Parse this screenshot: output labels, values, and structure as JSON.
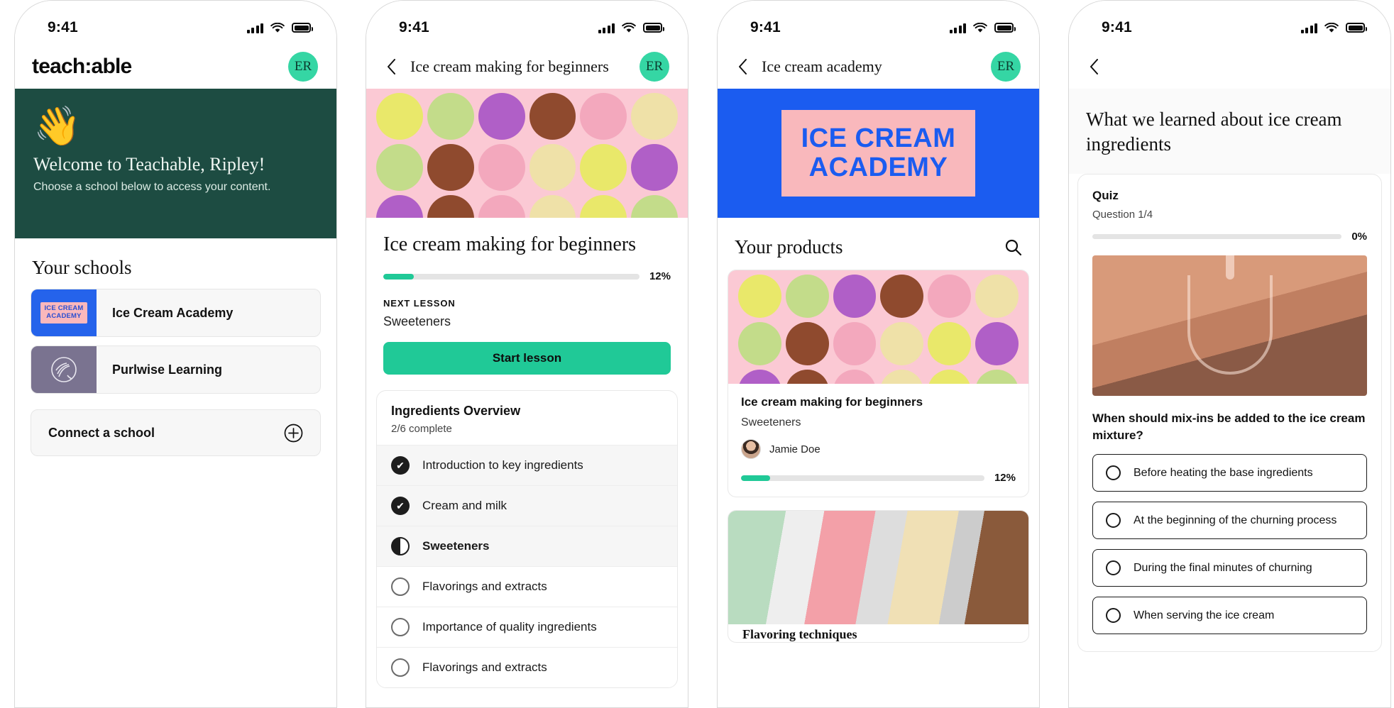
{
  "status_bar": {
    "time": "9:41",
    "signal_icon": "cellular-bars-icon",
    "wifi_icon": "wifi-icon",
    "battery_icon": "battery-icon"
  },
  "colors": {
    "brand_green": "#20c997",
    "avatar_green": "#35D6A4",
    "welcome_bg": "#1d4c42",
    "ica_blue": "#1b5cf0",
    "pink": "#fbc9d4"
  },
  "panel1": {
    "brand": "teach:able",
    "avatar_initials": "ER",
    "wave_icon": "waving-hand-icon",
    "welcome_title": "Welcome to Teachable, Ripley!",
    "welcome_subtitle": "Choose a school below to access your content.",
    "schools_heading": "Your schools",
    "schools": [
      {
        "name": "Ice Cream Academy",
        "logo_icon": "ice-cream-academy-logo",
        "logo_line1": "ICE CREAM",
        "logo_line2": "ACADEMY"
      },
      {
        "name": "Purlwise Learning",
        "logo_icon": "purlwise-learning-logo",
        "logo_caption": "Purlwise Learning"
      }
    ],
    "connect_label": "Connect a school",
    "connect_icon": "plus-circle-icon"
  },
  "panel2": {
    "nav_title": "Ice cream making for beginners",
    "avatar_initials": "ER",
    "back_icon": "chevron-left-icon",
    "hero_icon": "ice-cream-scoops-photo",
    "course_title": "Ice cream making for beginners",
    "progress_percent": "12%",
    "progress_value": 12,
    "eyebrow": "NEXT LESSON",
    "next_lesson": "Sweeteners",
    "start_button": "Start lesson",
    "module_title": "Ingredients Overview",
    "module_progress": "2/6 complete",
    "lessons": [
      {
        "label": "Introduction to key ingredients",
        "state": "done",
        "icon": "check-circle-filled-icon"
      },
      {
        "label": "Cream and milk",
        "state": "done",
        "icon": "check-circle-filled-icon"
      },
      {
        "label": "Sweeteners",
        "state": "current",
        "icon": "half-circle-icon"
      },
      {
        "label": "Flavorings and extracts",
        "state": "todo",
        "icon": "circle-outline-icon"
      },
      {
        "label": "Importance of quality ingredients",
        "state": "todo",
        "icon": "circle-outline-icon"
      },
      {
        "label": "Flavorings and extracts",
        "state": "todo",
        "icon": "circle-outline-icon"
      }
    ]
  },
  "panel3": {
    "nav_title": "Ice cream academy",
    "avatar_initials": "ER",
    "back_icon": "chevron-left-icon",
    "hero_line1": "ICE CREAM",
    "hero_line2": "ACADEMY",
    "products_title": "Your products",
    "search_icon": "search-icon",
    "products": [
      {
        "thumb_icon": "ice-cream-scoops-photo",
        "name": "Ice cream making for beginners",
        "lesson": "Sweeteners",
        "author": "Jamie Doe",
        "author_avatar": "user-photo-avatar",
        "progress_percent": "12%",
        "progress_value": 12
      },
      {
        "thumb_icon": "gelato-tray-photo",
        "name": "Flavoring techniques"
      }
    ]
  },
  "panel4": {
    "back_icon": "chevron-left-icon",
    "lesson_title": "What we learned about ice cream ingredients",
    "quiz_kicker": "Quiz",
    "question_counter": "Question 1/4",
    "progress_percent": "0%",
    "progress_value": 0,
    "media_icon": "whisk-mixing-photo",
    "question": "When should mix-ins be added to the ice cream mixture?",
    "options": [
      {
        "label": "Before heating the base ingredients",
        "icon": "radio-unselected-icon"
      },
      {
        "label": "At the beginning of the churning process",
        "icon": "radio-unselected-icon"
      },
      {
        "label": "During the final minutes of churning",
        "icon": "radio-unselected-icon"
      },
      {
        "label": "When serving the ice cream",
        "icon": "radio-unselected-icon"
      }
    ]
  }
}
